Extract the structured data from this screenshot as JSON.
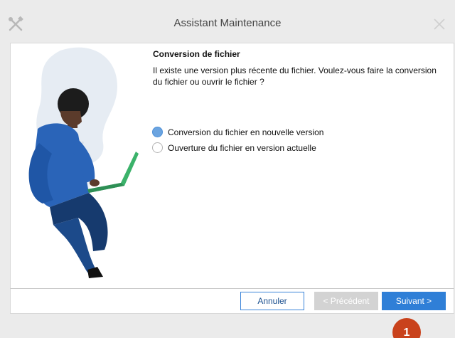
{
  "window": {
    "title": "Assistant Maintenance",
    "app_icon": "tools-icon",
    "close_icon": "close-icon"
  },
  "content": {
    "heading": "Conversion de fichier",
    "description": "Il existe une version plus récente du fichier. Voulez-vous faire la conversion du fichier ou ouvrir le fichier ?",
    "options": [
      {
        "label": "Conversion du fichier en nouvelle version",
        "selected": true
      },
      {
        "label": "Ouverture du fichier en version actuelle",
        "selected": false
      }
    ]
  },
  "buttons": {
    "cancel": "Annuler",
    "previous": "< Précédent",
    "next": "Suivant >"
  },
  "annotation": {
    "badge_number": "1",
    "badge_color": "#c9421c"
  },
  "colors": {
    "accent": "#2f7fd7",
    "radio_selected": "#6ba4e0",
    "disabled": "#d3d3d3"
  }
}
